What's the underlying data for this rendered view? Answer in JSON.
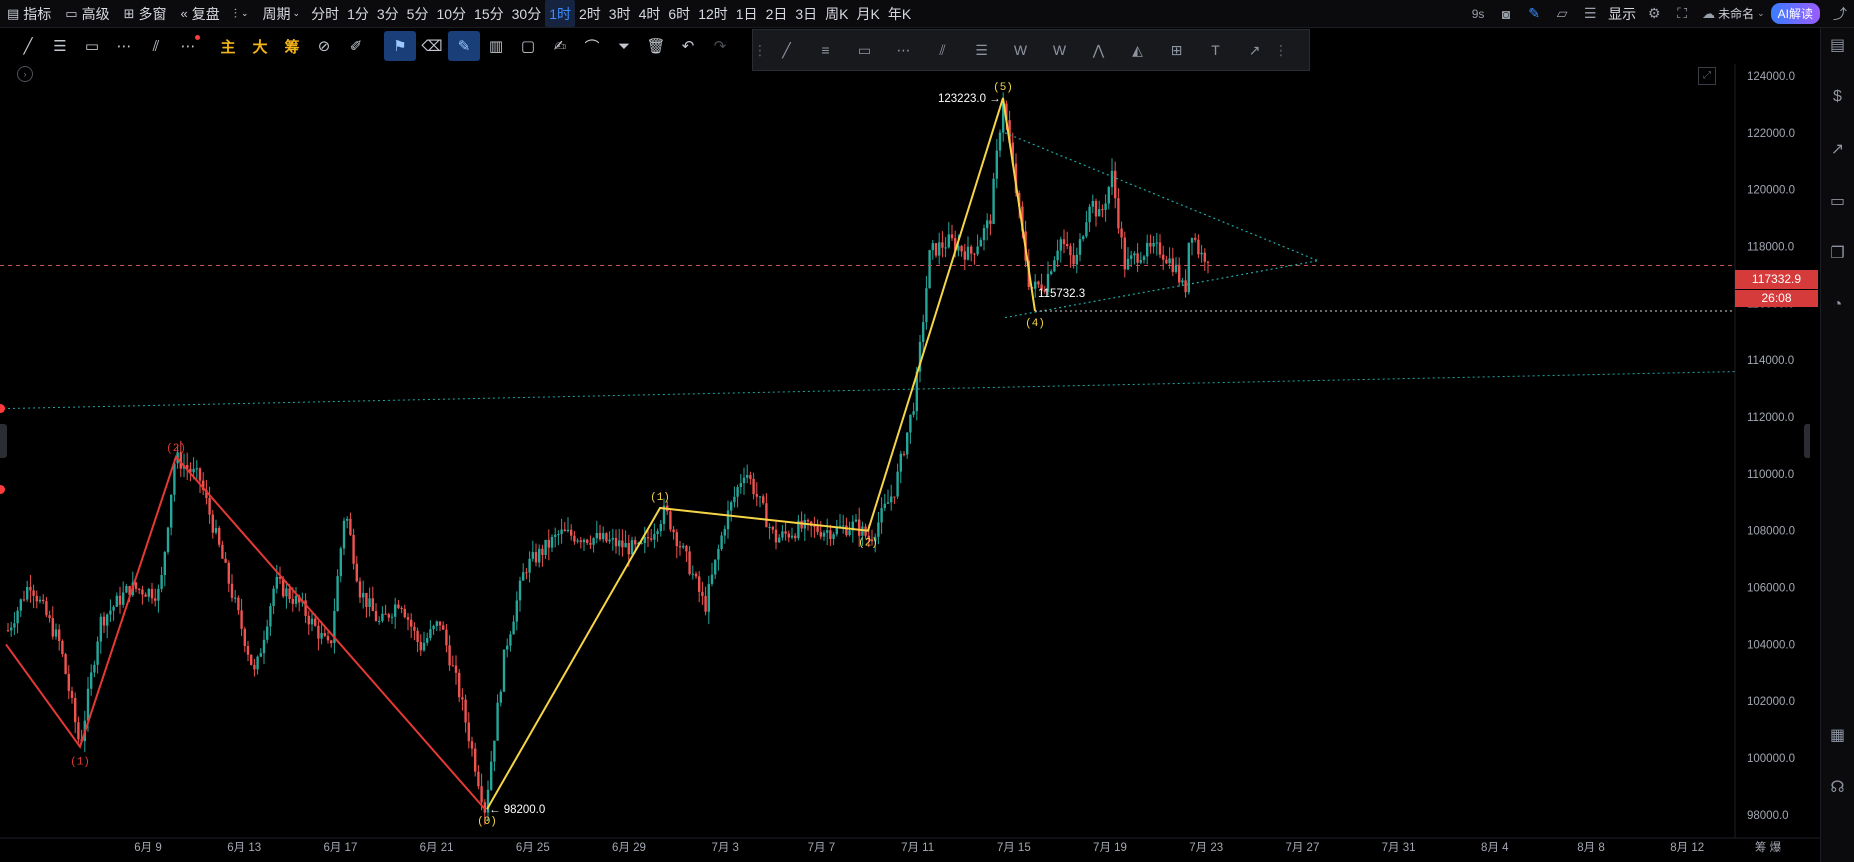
{
  "toolbar": {
    "indicators": "指标",
    "advanced": "高级",
    "multi_window": "多窗",
    "replay": "复盘",
    "period_menu": "周期",
    "periods": [
      "分时",
      "1分",
      "3分",
      "5分",
      "10分",
      "15分",
      "30分",
      "1时",
      "2时",
      "3时",
      "4时",
      "6时",
      "12时",
      "1日",
      "2日",
      "3日",
      "周K",
      "月K",
      "年K"
    ],
    "active_period": "1时"
  },
  "top_right": {
    "refresh": "9s",
    "display": "显示",
    "layout_name": "未命名",
    "ai_button": "AI解读"
  },
  "drawing_tools": {
    "main": "主",
    "big": "大",
    "chip": "筹"
  },
  "axis": {
    "y_ticks": [
      "124000.0",
      "122000.0",
      "120000.0",
      "118000.0",
      "116000.0",
      "114000.0",
      "112000.0",
      "110000.0",
      "108000.0",
      "106000.0",
      "104000.0",
      "102000.0",
      "100000.0",
      "98000.0"
    ],
    "x_ticks": [
      "6月 9",
      "6月 13",
      "6月 17",
      "6月 21",
      "6月 25",
      "6月 29",
      "7月 3",
      "7月 7",
      "7月 11",
      "7月 15",
      "7月 19",
      "7月 23",
      "7月 27",
      "7月 31",
      "8月 4",
      "8月 8",
      "8月 12"
    ],
    "corner": "筹 爆"
  },
  "price": {
    "current": "117332.9",
    "countdown": "26:08",
    "high_label": "123223.0",
    "low_label": "98200.0",
    "wave4_label": "115732.3"
  },
  "wave_labels": {
    "red": [
      "(1)",
      "(2)"
    ],
    "yellow": [
      "(0)",
      "(1)",
      "(2)",
      "(5)",
      "(4)"
    ]
  },
  "colors": {
    "up": "#26a69a",
    "down": "#ef5350",
    "red_wave": "#e53935",
    "yellow_wave": "#f5d547",
    "teal_line": "#21a6a1",
    "current_tag": "#d63b3b"
  }
}
